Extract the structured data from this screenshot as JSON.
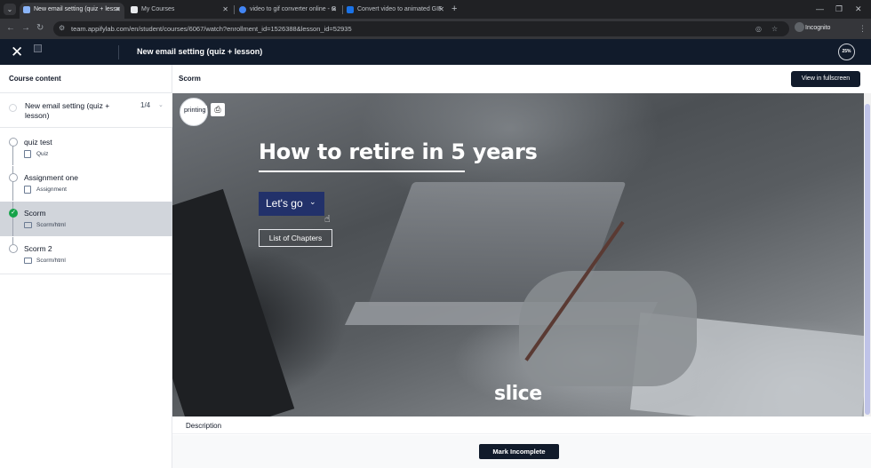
{
  "browser": {
    "tabs": [
      {
        "title": "New email setting (quiz + lesso",
        "active": true
      },
      {
        "title": "My Courses",
        "active": false
      },
      {
        "title": "video to gif converter online - G",
        "active": false
      },
      {
        "title": "Convert video to animated GIF",
        "active": false
      }
    ],
    "url": "team.appifylab.com/en/student/courses/6067/watch?enrollment_id=1526388&lesson_id=52935",
    "incognito_label": "Incognito",
    "new_tab_glyph": "+",
    "minimize_glyph": "—",
    "maximize_glyph": "❐",
    "close_glyph": "✕"
  },
  "header": {
    "lesson_title": "New email setting (quiz + lesson)",
    "progress": "25%"
  },
  "sidebar": {
    "heading": "Course content",
    "section": {
      "title": "New email setting (quiz + lesson)",
      "count": "1/4"
    },
    "lessons": [
      {
        "title": "quiz test",
        "type": "Quiz",
        "icon": "document-icon",
        "completed": false,
        "active": false
      },
      {
        "title": "Assignment one",
        "type": "Assignment",
        "icon": "document-icon",
        "completed": false,
        "active": false
      },
      {
        "title": "Scorm",
        "type": "Scorm/html",
        "icon": "video-icon",
        "completed": true,
        "active": true
      },
      {
        "title": "Scorm 2",
        "type": "Scorm/html",
        "icon": "video-icon",
        "completed": false,
        "active": false
      }
    ]
  },
  "main": {
    "scorm_label": "Scorm",
    "fullscreen_label": "View in fullscreen",
    "scorm": {
      "print_text": "printing",
      "heading": "How to retire in 5 years",
      "letsgo_label": "Let's go",
      "chapters_label": "List of Chapters",
      "brand": "slice"
    },
    "description_label": "Description",
    "mark_incomplete_label": "Mark Incomplete"
  },
  "colors": {
    "header_bg": "#111b2b",
    "accent_button": "#22316a",
    "completed": "#16a34a"
  }
}
